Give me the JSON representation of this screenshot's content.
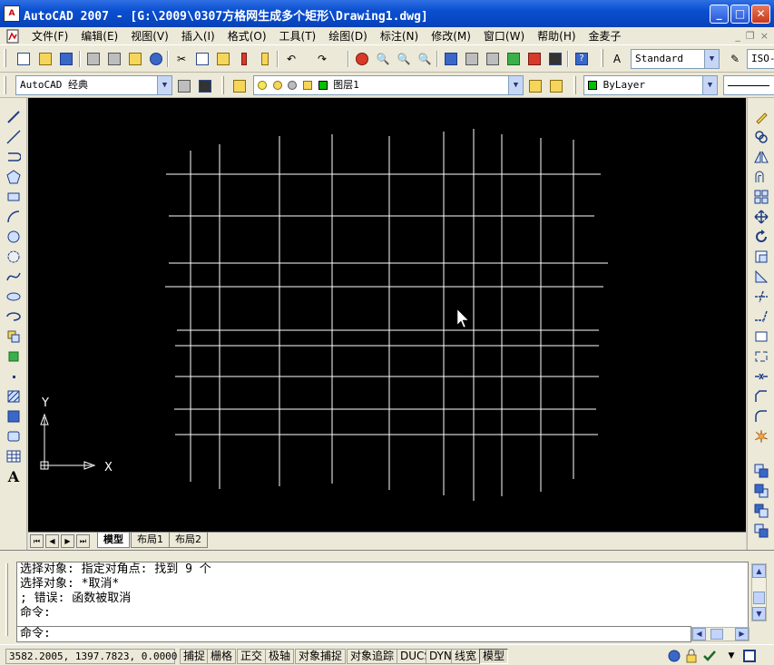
{
  "window": {
    "title": "AutoCAD 2007 - [G:\\2009\\0307方格网生成多个矩形\\Drawing1.dwg]",
    "app_icon_label": "A",
    "btn_minimize": "_",
    "btn_maximize": "□",
    "btn_close": "✕"
  },
  "menu": {
    "items": [
      "文件(F)",
      "编辑(E)",
      "视图(V)",
      "插入(I)",
      "格式(O)",
      "工具(T)",
      "绘图(D)",
      "标注(N)",
      "修改(M)",
      "窗口(W)",
      "帮助(H)",
      "金麦子"
    ],
    "mdi_minimize": "_",
    "mdi_restore": "❐",
    "mdi_close": "×"
  },
  "toolbar": {
    "text_style": "Standard",
    "dim_style_partial": "ISO-",
    "workspace": "AutoCAD 经典",
    "layer": "图层1",
    "color": "ByLayer",
    "layer_color": "#00c000"
  },
  "canvas": {
    "background": "#000000",
    "line_color": "#ffffff",
    "ucs_x_label": "X",
    "ucs_y_label": "Y"
  },
  "layout_tabs": {
    "nav": [
      "⏮",
      "◀",
      "▶",
      "⏭"
    ],
    "tabs": [
      "模型",
      "布局1",
      "布局2"
    ],
    "active": "模型"
  },
  "command": {
    "history": [
      "选择对象: 指定对角点: 找到 9 个",
      "选择对象: *取消*",
      "; 错误: 函数被取消",
      "命令:"
    ],
    "prompt": "命令:"
  },
  "status": {
    "coords": "3582.2005, 1397.7823, 0.0000",
    "toggles": [
      "捕捉",
      "栅格",
      "正交",
      "极轴",
      "对象捕捉",
      "对象追踪",
      "DUCS",
      "DYN",
      "线宽",
      "模型"
    ],
    "pressed": [
      "模型"
    ]
  }
}
